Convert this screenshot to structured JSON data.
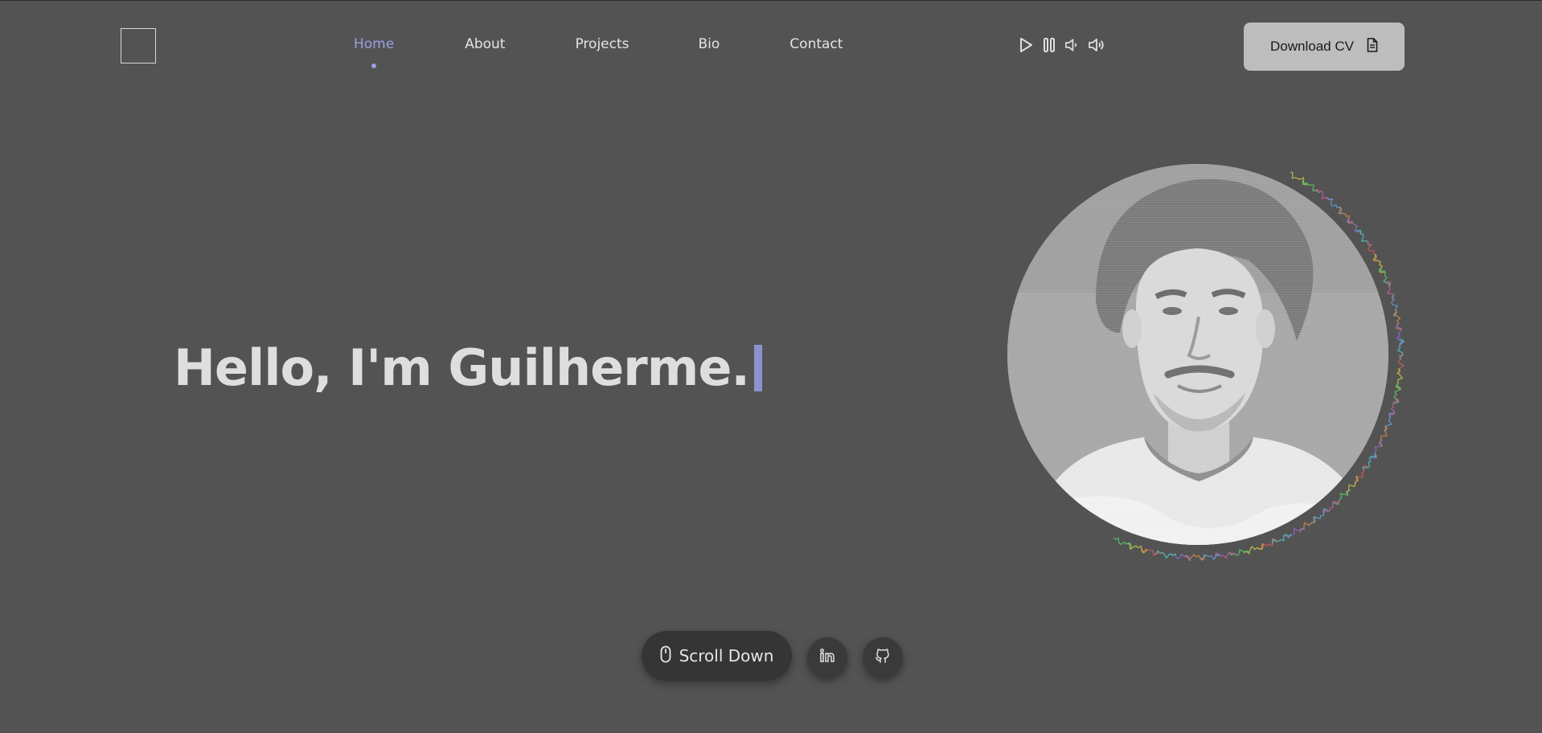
{
  "nav": {
    "items": [
      {
        "label": "Home",
        "active": true
      },
      {
        "label": "About",
        "active": false
      },
      {
        "label": "Projects",
        "active": false
      },
      {
        "label": "Bio",
        "active": false
      },
      {
        "label": "Contact",
        "active": false
      }
    ]
  },
  "audio_controls": [
    {
      "icon": "play-icon"
    },
    {
      "icon": "pause-icon"
    },
    {
      "icon": "volume-low-icon"
    },
    {
      "icon": "volume-high-icon"
    }
  ],
  "cv_button": {
    "label": "Download CV",
    "icon": "document-icon"
  },
  "hero": {
    "greeting": "Hello, I'm Guilherme."
  },
  "scroll": {
    "label": "Scroll Down",
    "icon": "mouse-icon"
  },
  "social": [
    {
      "icon": "linkedin-icon"
    },
    {
      "icon": "github-icon"
    }
  ],
  "colors": {
    "background": "#535353",
    "accent": "#9aa0e6",
    "caret": "#8c91d0",
    "button": "#bdbdbd"
  }
}
